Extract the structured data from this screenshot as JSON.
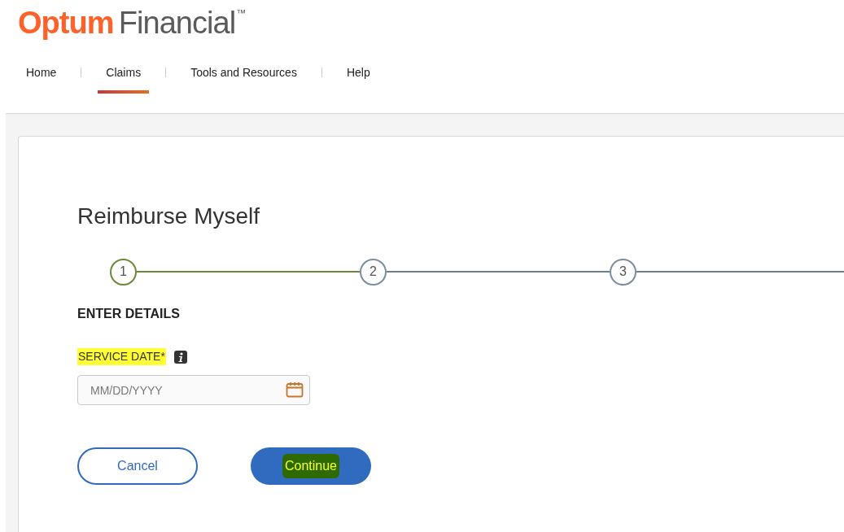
{
  "logo": {
    "brand": "Optum",
    "product": "Financial",
    "mark": "™"
  },
  "nav": [
    {
      "label": "Home",
      "selected": false
    },
    {
      "label": "Claims",
      "selected": true
    },
    {
      "label": "Tools and Resources",
      "selected": false
    },
    {
      "label": "Help",
      "selected": false
    }
  ],
  "page_title": "Reimburse Myself",
  "steps": [
    {
      "number": "1",
      "selected": true
    },
    {
      "number": "2",
      "selected": false
    },
    {
      "number": "3",
      "selected": false
    }
  ],
  "section_heading": "ENTER DETAILS",
  "service_date": {
    "label": "SERVICE DATE*",
    "highlighted": true,
    "placeholder": "MM/DD/YYYY"
  },
  "buttons": [
    {
      "label": "Cancel",
      "kind": "secondary",
      "highlighted": false
    },
    {
      "label": "Continue",
      "kind": "primary",
      "highlighted": true
    }
  ]
}
